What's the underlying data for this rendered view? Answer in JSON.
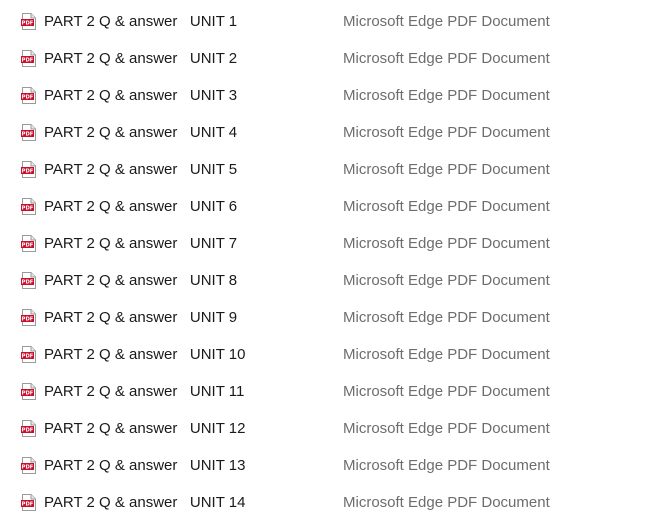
{
  "file_list": {
    "icon": "pdf-file-icon",
    "icon_label": "PDF",
    "accent_color": "#c8102e",
    "items": [
      {
        "name": "PART 2 Q & answer   UNIT 1",
        "type": "Microsoft Edge PDF Document"
      },
      {
        "name": "PART 2 Q & answer   UNIT 2",
        "type": "Microsoft Edge PDF Document"
      },
      {
        "name": "PART 2 Q & answer   UNIT 3",
        "type": "Microsoft Edge PDF Document"
      },
      {
        "name": "PART 2 Q & answer   UNIT 4",
        "type": "Microsoft Edge PDF Document"
      },
      {
        "name": "PART 2 Q & answer   UNIT 5",
        "type": "Microsoft Edge PDF Document"
      },
      {
        "name": "PART 2 Q & answer   UNIT 6",
        "type": "Microsoft Edge PDF Document"
      },
      {
        "name": "PART 2 Q & answer   UNIT 7",
        "type": "Microsoft Edge PDF Document"
      },
      {
        "name": "PART 2 Q & answer   UNIT 8",
        "type": "Microsoft Edge PDF Document"
      },
      {
        "name": "PART 2 Q & answer   UNIT 9",
        "type": "Microsoft Edge PDF Document"
      },
      {
        "name": "PART 2 Q & answer   UNIT 10",
        "type": "Microsoft Edge PDF Document"
      },
      {
        "name": "PART 2 Q & answer   UNIT 11",
        "type": "Microsoft Edge PDF Document"
      },
      {
        "name": "PART 2 Q & answer   UNIT 12",
        "type": "Microsoft Edge PDF Document"
      },
      {
        "name": "PART 2 Q & answer   UNIT 13",
        "type": "Microsoft Edge PDF Document"
      },
      {
        "name": "PART 2 Q & answer   UNIT 14",
        "type": "Microsoft Edge PDF Document"
      }
    ]
  }
}
